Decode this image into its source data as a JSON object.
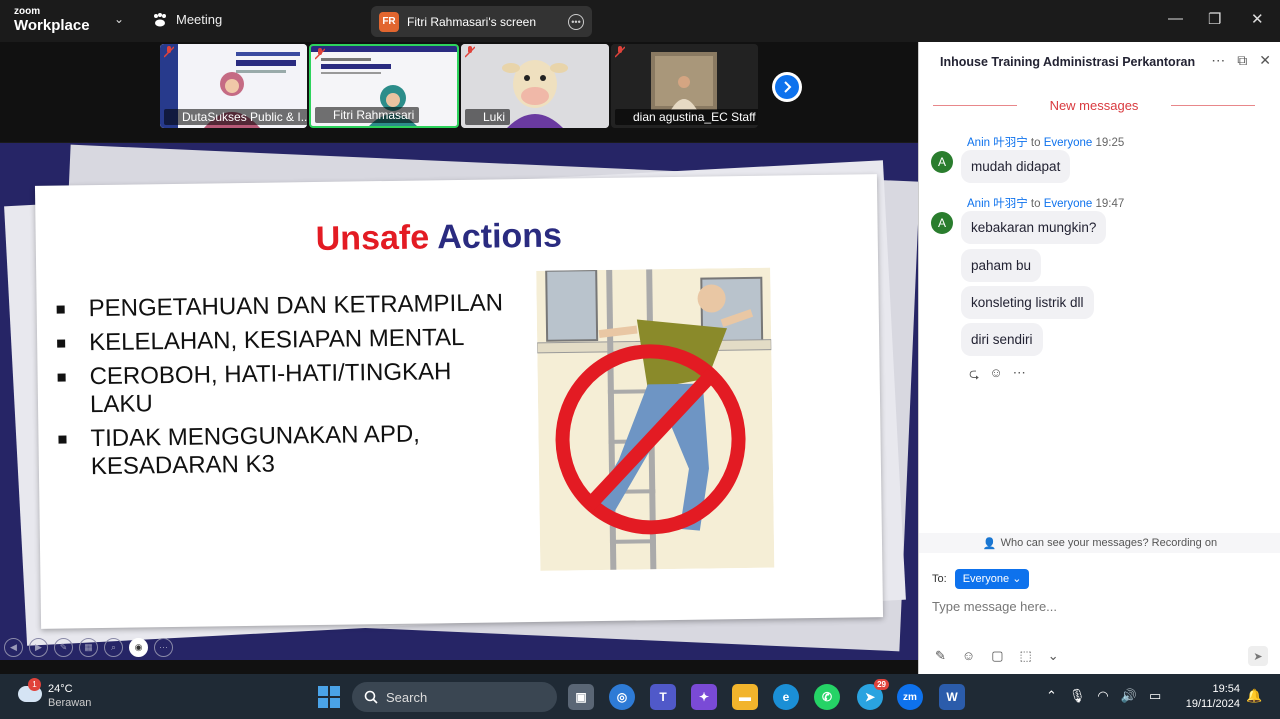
{
  "titlebar": {
    "logo_top": "zoom",
    "logo_bottom": "Workplace",
    "meeting_label": "Meeting",
    "screen_badge": "FR",
    "screen_label": "Fitri Rahmasari's screen"
  },
  "participants": [
    {
      "name": "DutaSukses Public & I..."
    },
    {
      "name": "Fitri Rahmasari"
    },
    {
      "name": "Luki"
    },
    {
      "name": "dian agustina_EC Staff"
    }
  ],
  "slide": {
    "title_part1": "Unsafe",
    "title_part2": "Actions",
    "bullets": [
      "PENGETAHUAN DAN KETRAMPILAN",
      "KELELAHAN, KESIAPAN MENTAL",
      "CEROBOH, HATI-HATI/TINGKAH LAKU",
      "TIDAK MENGGUNAKAN APD, KESADARAN K3"
    ]
  },
  "chat": {
    "title": "Inhouse Training Administrasi Perkantoran",
    "new_messages": "New messages",
    "messages": [
      {
        "avatar": "A",
        "sender": "Anin 叶羽宁",
        "to": "to",
        "recipient": "Everyone",
        "time": "19:25",
        "texts": [
          "mudah didapat"
        ]
      },
      {
        "avatar": "A",
        "sender": "Anin 叶羽宁",
        "to": "to",
        "recipient": "Everyone",
        "time": "19:47",
        "texts": [
          "kebakaran mungkin?",
          "paham bu",
          "konsleting listrik dll",
          "diri sendiri"
        ]
      }
    ],
    "privacy": "Who can see your messages? Recording on",
    "to_label": "To:",
    "to_value": "Everyone",
    "placeholder": "Type message here..."
  },
  "taskbar": {
    "weather_badge": "1",
    "temp": "24°C",
    "condition": "Berawan",
    "search": "Search",
    "telegram_badge": "29",
    "time": "19:54",
    "date": "19/11/2024"
  },
  "colors": {
    "accent": "#0e72ed",
    "slide_bg": "#262566",
    "title_red": "#e31b23",
    "title_blue": "#2a2b80",
    "new_messages": "#d93a3f"
  }
}
